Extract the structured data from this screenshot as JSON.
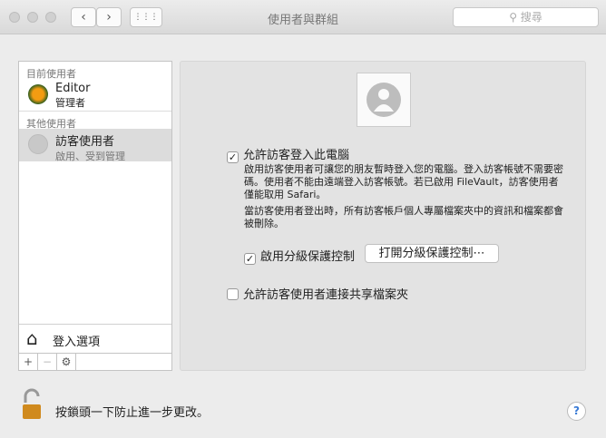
{
  "window": {
    "title": "使用者與群組",
    "search_placeholder": "搜尋",
    "back": "‹",
    "forward": "›",
    "grid": "⋮⋮⋮"
  },
  "sidebar": {
    "current_header": "目前使用者",
    "current_user": {
      "name": "Editor",
      "role": "管理者"
    },
    "other_header": "其他使用者",
    "other_user": {
      "name": "訪客使用者",
      "status": "啟用、受到管理"
    },
    "login_options": "登入選項",
    "add": "+",
    "remove": "−",
    "gear": "⚙"
  },
  "main": {
    "allow_guest": {
      "label": "允許訪客登入此電腦",
      "checked": true
    },
    "desc1": "啟用訪客使用者可讓您的朋友暫時登入您的電腦。登入訪客帳號不需要密碼。使用者不能由遠端登入訪客帳號。若已啟用 FileVault，訪客使用者僅能取用 Safari。",
    "desc2": "當訪客使用者登出時，所有訪客帳戶個人專屬檔案夾中的資訊和檔案都會被刪除。",
    "parental": {
      "label": "啟用分級保護控制",
      "checked": true
    },
    "open_parental": "打開分級保護控制⋯",
    "shared": {
      "label": "允許訪客使用者連接共享檔案夾",
      "checked": false
    }
  },
  "footer": {
    "lock_text": "按鎖頭一下防止進一步更改。",
    "help": "?"
  }
}
